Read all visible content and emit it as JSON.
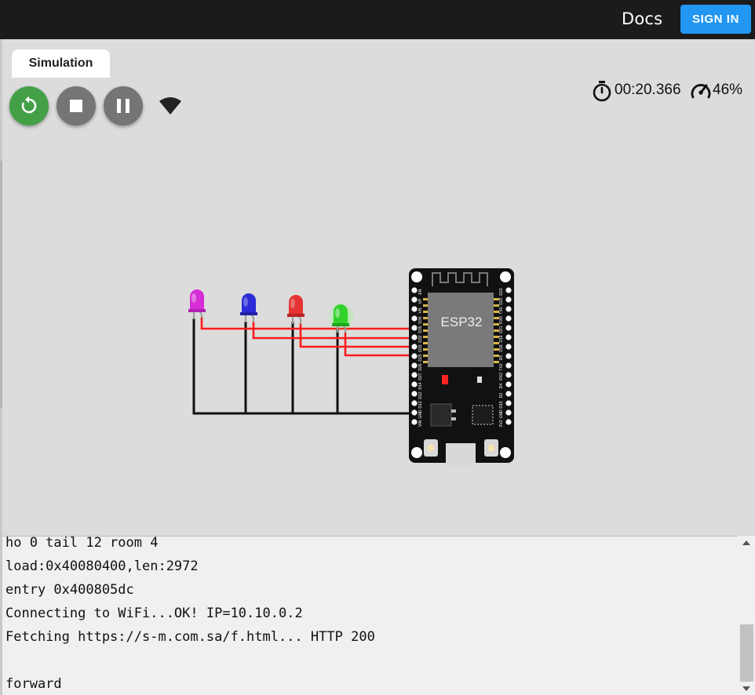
{
  "header": {
    "docs_label": "Docs",
    "signin_label": "SIGN IN"
  },
  "tabs": [
    {
      "label": "Simulation"
    }
  ],
  "controls": {
    "restart_icon": "restart-icon",
    "stop_icon": "stop-icon",
    "pause_icon": "pause-icon",
    "wifi_icon": "wifi-icon"
  },
  "status": {
    "elapsed": "00:20.366",
    "speed": "46%"
  },
  "board": {
    "label": "ESP32",
    "left_pins": [
      "EN",
      "VP",
      "VN",
      "D34",
      "D35",
      "D32",
      "D33",
      "D25",
      "D26",
      "D27",
      "D14",
      "D12",
      "D13",
      "GND",
      "VIN"
    ],
    "right_pins": [
      "D23",
      "D22",
      "TX0",
      "RX0",
      "D21",
      "D19",
      "D18",
      "D5",
      "TX2",
      "RX2",
      "D4",
      "D2",
      "D15",
      "GND",
      "3V3"
    ]
  },
  "leds": [
    {
      "name": "magenta",
      "color": "#d62ed6"
    },
    {
      "name": "blue",
      "color": "#2b2bd8"
    },
    {
      "name": "red",
      "color": "#e53333"
    },
    {
      "name": "green",
      "color": "#33d12b",
      "lit": true
    }
  ],
  "colors": {
    "accent": "#2196f3",
    "restart": "#43a047",
    "wire_signal": "#ff0000",
    "wire_ground": "#111111",
    "canvas": "#dcdcdc"
  },
  "console": {
    "lines": [
      "ho 0 tail 12 room 4",
      "load:0x40080400,len:2972",
      "entry 0x400805dc",
      "Connecting to WiFi...OK! IP=10.10.0.2",
      "Fetching https://s-m.com.sa/f.html... HTTP 200",
      "",
      "forward"
    ]
  }
}
